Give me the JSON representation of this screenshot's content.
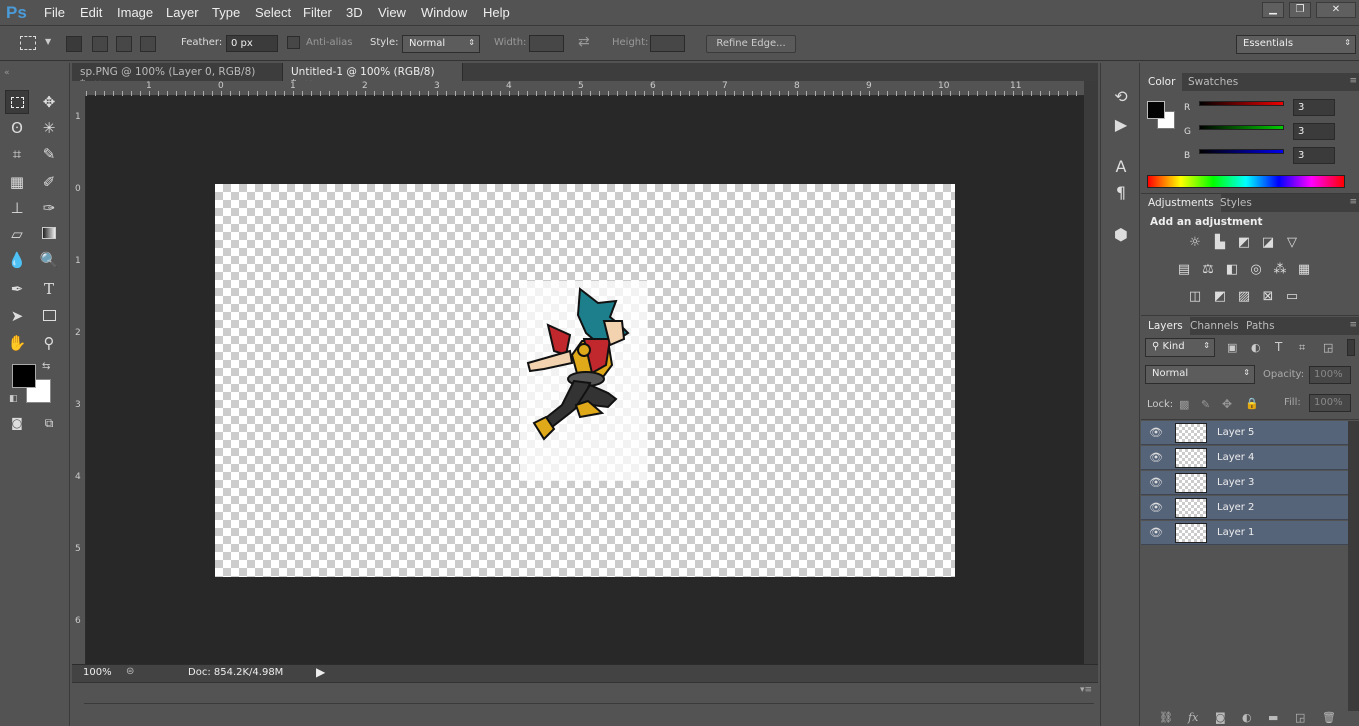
{
  "app": {
    "logo": "Ps"
  },
  "menu": [
    "File",
    "Edit",
    "Image",
    "Layer",
    "Type",
    "Select",
    "Filter",
    "3D",
    "View",
    "Window",
    "Help"
  ],
  "window_controls": {
    "minimize": "▁",
    "restore": "❐",
    "close": "✕"
  },
  "options": {
    "feather_label": "Feather:",
    "feather_value": "0 px",
    "antialias_label": "Anti-alias",
    "style_label": "Style:",
    "style_value": "Normal",
    "width_label": "Width:",
    "height_label": "Height:",
    "refine_edge": "Refine Edge...",
    "workspace": "Essentials"
  },
  "tabs": [
    {
      "label": "sp.PNG @ 100% (Layer 0, RGB/8) *",
      "close": "×"
    },
    {
      "label": "Untitled-1 @ 100% (RGB/8) *",
      "close": "×"
    }
  ],
  "ruler_h": [
    "1",
    "0",
    "1",
    "2",
    "3",
    "4",
    "5",
    "6",
    "7",
    "8",
    "9",
    "10",
    "11"
  ],
  "ruler_v": [
    "1",
    "0",
    "1",
    "2",
    "3",
    "4",
    "5",
    "6"
  ],
  "status": {
    "zoom": "100%",
    "doc": "Doc: 854.2K/4.98M"
  },
  "color_panel": {
    "tabs": [
      "Color",
      "Swatches"
    ],
    "channels": [
      {
        "label": "R",
        "value": "3",
        "color": "#cc0000"
      },
      {
        "label": "G",
        "value": "3",
        "color": "#00aa00"
      },
      {
        "label": "B",
        "value": "3",
        "color": "#0000cc"
      }
    ],
    "foreground": "#030303",
    "background": "#ffffff"
  },
  "adjustments_panel": {
    "tabs": [
      "Adjustments",
      "Styles"
    ],
    "title": "Add an adjustment"
  },
  "layers_panel": {
    "tabs": [
      "Layers",
      "Channels",
      "Paths"
    ],
    "kind": "Kind",
    "blend_mode": "Normal",
    "opacity_label": "Opacity:",
    "opacity_value": "100%",
    "lock_label": "Lock:",
    "fill_label": "Fill:",
    "fill_value": "100%",
    "layers": [
      "Layer 5",
      "Layer 4",
      "Layer 3",
      "Layer 2",
      "Layer 1"
    ],
    "selection_color": "#56647a"
  }
}
